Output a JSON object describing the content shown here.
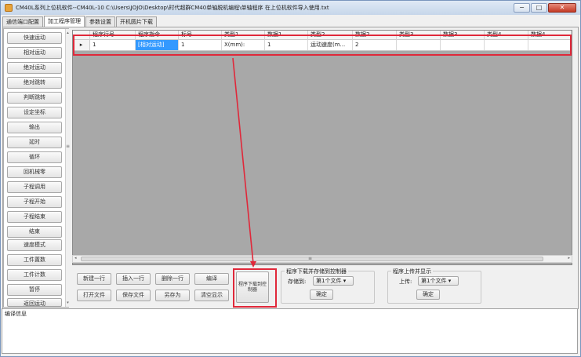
{
  "window": {
    "title": "CM40L系列上位机软件--CM40L-10   C:\\Users\\JOJO\\Desktop\\时代超群CM40单轴脱机编程\\单轴程序 在上位机软件导入使用.txt",
    "controls": {
      "minimize": "−",
      "maximize": "□",
      "close": "✕"
    }
  },
  "tabs": [
    {
      "label": "通信端口配置"
    },
    {
      "label": "加工程序管理"
    },
    {
      "label": "参数设置"
    },
    {
      "label": "开机圆片下载"
    }
  ],
  "sidebar": {
    "items": [
      {
        "label": "快速运动"
      },
      {
        "label": "相对运动"
      },
      {
        "label": "绝对运动"
      },
      {
        "label": "绝对跳转"
      },
      {
        "label": "判断跳转"
      },
      {
        "label": "设定坐标"
      },
      {
        "label": "输出"
      },
      {
        "label": "延时"
      },
      {
        "label": "循环"
      },
      {
        "label": "回机械零"
      },
      {
        "label": "子程调用"
      },
      {
        "label": "子程开始"
      },
      {
        "label": "子程结束"
      },
      {
        "label": "结束"
      },
      {
        "label": "速度模式"
      },
      {
        "label": "工件置数"
      },
      {
        "label": "工件计数"
      },
      {
        "label": "暂停"
      },
      {
        "label": "返回运动"
      }
    ]
  },
  "grid": {
    "headers": [
      "程序行号",
      "程序指令",
      "标号",
      "类型1",
      "数据1",
      "类型2",
      "数据2",
      "类型3",
      "数据3",
      "类型4",
      "数据4"
    ],
    "rows": [
      {
        "indicator": "▸",
        "cells": [
          "1",
          "[相对运动]",
          "1",
          "X(mm):",
          "1",
          "运动速度(m...",
          "2",
          "",
          "",
          "",
          ""
        ]
      }
    ]
  },
  "hscroll": {
    "center_mark": "≡",
    "left": "◂",
    "right": "▸"
  },
  "buttons": {
    "new_row": "新建一行",
    "insert_row": "插入一行",
    "delete_row": "删除一行",
    "compile": "编译",
    "open_file": "打开文件",
    "save_file": "保存文件",
    "save_as": "另存为",
    "clear_display": "清空显示",
    "download": "程序下载到控制器"
  },
  "download_group": {
    "title": "程序下载并存储到控制器",
    "label": "存储到:",
    "selected": "第1个文件",
    "confirm": "确定"
  },
  "upload_group": {
    "title": "程序上传并显示",
    "label": "上传:",
    "selected": "第1个文件",
    "confirm": "确定"
  },
  "log": {
    "title": "编译信息"
  },
  "colors": {
    "annotation": "#e0283a",
    "selection": "#3399ff"
  }
}
